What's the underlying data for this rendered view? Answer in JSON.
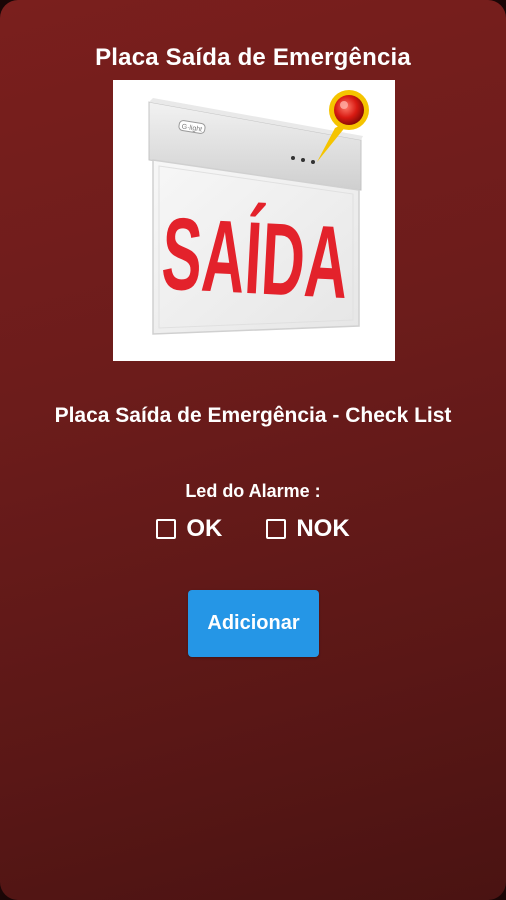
{
  "header": {
    "title": "Placa Saída de Emergência"
  },
  "product": {
    "sign_text": "SAÍDA",
    "brand_text": "G·light"
  },
  "checklist": {
    "title": "Placa Saída de Emergência - Check List",
    "field_label": "Led do Alarme :",
    "options": [
      {
        "label": "OK",
        "checked": false
      },
      {
        "label": "NOK",
        "checked": false
      }
    ]
  },
  "actions": {
    "add_label": "Adicionar"
  },
  "colors": {
    "background": "#6c1c1b",
    "button": "#2596e6",
    "sign_red": "#e3222b"
  }
}
